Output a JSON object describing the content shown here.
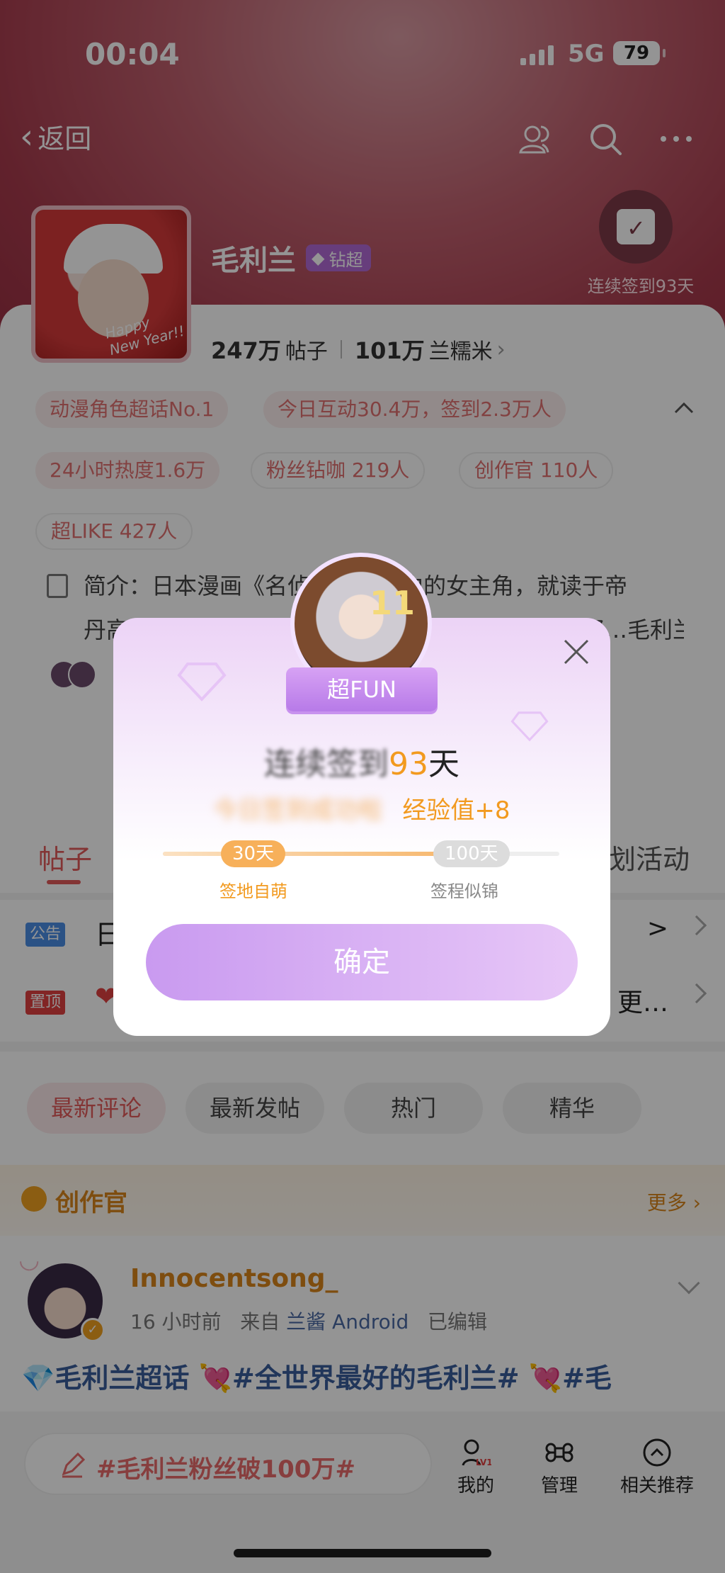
{
  "status_bar": {
    "time": "00:04",
    "network": "5G",
    "battery": "79"
  },
  "nav": {
    "back_label": "返回"
  },
  "topic": {
    "name": "毛利兰",
    "badge": "钻超",
    "checkin_text": "连续签到93天",
    "posts_count": "247万",
    "posts_label": "帖子",
    "fans_count": "101万",
    "fans_label": "兰糯米",
    "avatar_text": "Happy New Year!!"
  },
  "tags": [
    "动漫角色超话No.1",
    "今日互动30.4万，签到2.3万人",
    "24小时热度1.6万",
    "粉丝钻咖 219人",
    "创作官 110人",
    "超LIKE 427人"
  ],
  "intro": {
    "line1": "简介：日本漫画《名侦探柯南》中的女主角，就读于帝",
    "line2": "丹高中，与工藤新一是青梅竹马，其父是毛利小五郎…毛利兰，山刚…"
  },
  "tabs": {
    "left": "帖子",
    "right": "划活动"
  },
  "pinned": [
    {
      "label": "公告",
      "label_color": "#4a8ee6",
      "text": "日",
      "right": ">"
    },
    {
      "label": "置顶",
      "label_color": "#e04040",
      "text": "❤",
      "right": "更…"
    }
  ],
  "filters": [
    "最新评论",
    "最新发帖",
    "热门",
    "精华"
  ],
  "creator": {
    "title": "创作官",
    "more": "更多"
  },
  "post": {
    "username": "Innocentsong_",
    "time": "16 小时前",
    "from_label": "来自",
    "from_source": "兰酱 Android",
    "edited": "已编辑",
    "content": "💎毛利兰超话 💘#全世界最好的毛利兰# 💘#毛"
  },
  "bottom": {
    "compose_placeholder": "#毛利兰粉丝破100万#",
    "mine": "我的",
    "manage": "管理",
    "related": "相关推荐"
  },
  "modal": {
    "ribbon": "超FUN",
    "title_blurred": "连续签到",
    "title_days": "93",
    "title_unit": "天",
    "subtitle_blurred": "今日签到成功啦",
    "exp": "经验值+8",
    "milestone1": "30天",
    "milestone1_label": "签地自萌",
    "milestone2": "100天",
    "milestone2_label": "签程似锦",
    "progress": 0.8,
    "confirm": "确定"
  }
}
